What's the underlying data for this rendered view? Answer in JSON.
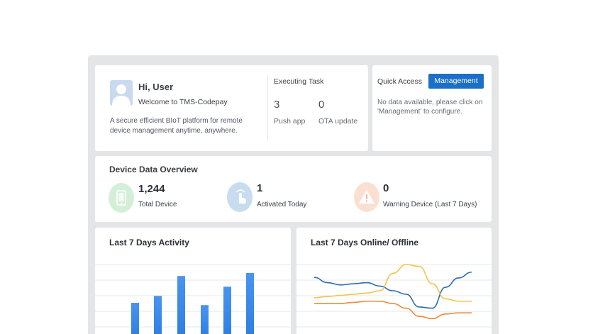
{
  "welcome": {
    "greeting": "Hi, User",
    "welcome_line": "Welcome to TMS-Codepay",
    "description": "A secure efficient BIoT platform for remote device management anytime, anywhere."
  },
  "executing_task": {
    "title": "Executing Task",
    "items": [
      {
        "value": "3",
        "label": "Push app"
      },
      {
        "value": "0",
        "label": "OTA update"
      }
    ]
  },
  "quick_access": {
    "title": "Quick Access",
    "button_label": "Management",
    "empty_text": "No data available, please click on 'Management' to  configure."
  },
  "overview": {
    "title": "Device Data Overview",
    "stats": [
      {
        "value": "1,244",
        "label": "Total Device",
        "icon": "phone-icon",
        "color": "#d3efd8"
      },
      {
        "value": "1",
        "label": "Activated Today",
        "icon": "tap-hand-icon",
        "color": "#c8dcef"
      },
      {
        "value": "0",
        "label": "Warning Device (Last 7 Days)",
        "icon": "warning-icon",
        "color": "#fbe0d2"
      }
    ]
  },
  "activity_chart": {
    "title": "Last 7 Days Activity",
    "chart_data": {
      "type": "bar",
      "bar_color": "#2a7de1",
      "values": [
        50,
        59,
        85,
        47,
        71,
        89
      ],
      "ylim": [
        0,
        100
      ],
      "grid": true
    }
  },
  "online_chart": {
    "title": "Last 7 Days Online/ Offline",
    "chart_data": {
      "type": "line",
      "grid": true,
      "series": [
        {
          "color": "#2b6cb0",
          "values": [
            73,
            64,
            60,
            62,
            64,
            58,
            50,
            44,
            22,
            20,
            56,
            72,
            82
          ]
        },
        {
          "color": "#f5c24c",
          "values": [
            38,
            40,
            42,
            44,
            46,
            50,
            80,
            95,
            92,
            62,
            36,
            32,
            32
          ]
        },
        {
          "color": "#ee8a3a",
          "values": [
            28,
            28,
            28,
            30,
            32,
            32,
            28,
            20,
            6,
            2,
            10,
            12,
            12
          ]
        }
      ]
    }
  }
}
